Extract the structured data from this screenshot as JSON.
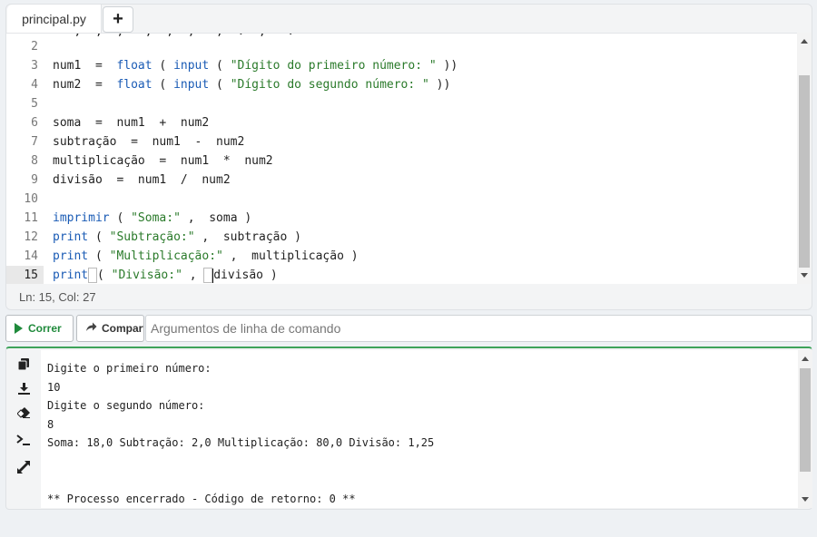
{
  "editor": {
    "tab_label": "principal.py",
    "add_tab_label": "+",
    "partial_line_text": "   ,  ,  ,   ,  ,  ,   ,  .  ,   :",
    "status": "Ln: 15, Col: 27",
    "lines": [
      {
        "n": "2",
        "html": ""
      },
      {
        "n": "3",
        "html": "num1  =  <span class=\"kw\">float</span> ( <span class=\"kw\">input</span> ( <span class=\"str\">\"Dígito do primeiro número: \"</span> ))"
      },
      {
        "n": "4",
        "html": "num2  =  <span class=\"kw\">float</span> ( <span class=\"kw\">input</span> ( <span class=\"str\">\"Dígito do segundo número: \"</span> ))"
      },
      {
        "n": "5",
        "html": ""
      },
      {
        "n": "6",
        "html": "soma  =  num1  +  num2"
      },
      {
        "n": "7",
        "html": "subtração  =  num1  -  num2"
      },
      {
        "n": "8",
        "html": "multiplicação  =  num1  *  num2"
      },
      {
        "n": "9",
        "html": "divisão  =  num1  /  num2"
      },
      {
        "n": "10",
        "html": ""
      },
      {
        "n": "11",
        "html": "<span class=\"kw\">imprimir</span> ( <span class=\"str\">\"Soma:\"</span> ,  soma )"
      },
      {
        "n": "12",
        "html": "<span class=\"kw\">print</span> ( <span class=\"str\">\"Subtração:\"</span> ,  subtração )"
      },
      {
        "n": "14",
        "html": "<span class=\"kw\">print</span> ( <span class=\"str\">\"Multiplicação:\"</span> ,  multiplicação )"
      },
      {
        "n": "15",
        "html": "<span class=\"kw\">print</span><span class=\"bracket-box\"> </span>( <span class=\"str\">\"Divisão:\"</span> , <span class=\"bracket-box\"> </span><span class=\"cursor-mark\"></span>divisão )",
        "active": true
      }
    ]
  },
  "toolbar": {
    "run_label": "Correr",
    "share_label": "Comparti",
    "args_placeholder": "Argumentos de linha de comando"
  },
  "console": {
    "tools": [
      "copy-icon",
      "download-icon",
      "eraser-icon",
      "terminal-icon",
      "expand-icon"
    ],
    "lines": [
      "Digite o primeiro número:",
      "10",
      "Digite o segundo número:",
      "8",
      "Soma: 18,0 Subtração: 2,0 Multiplicação: 80,0 Divisão: 1,25",
      "",
      "",
      "** Processo encerrado - Código de retorno: 0 **"
    ]
  }
}
